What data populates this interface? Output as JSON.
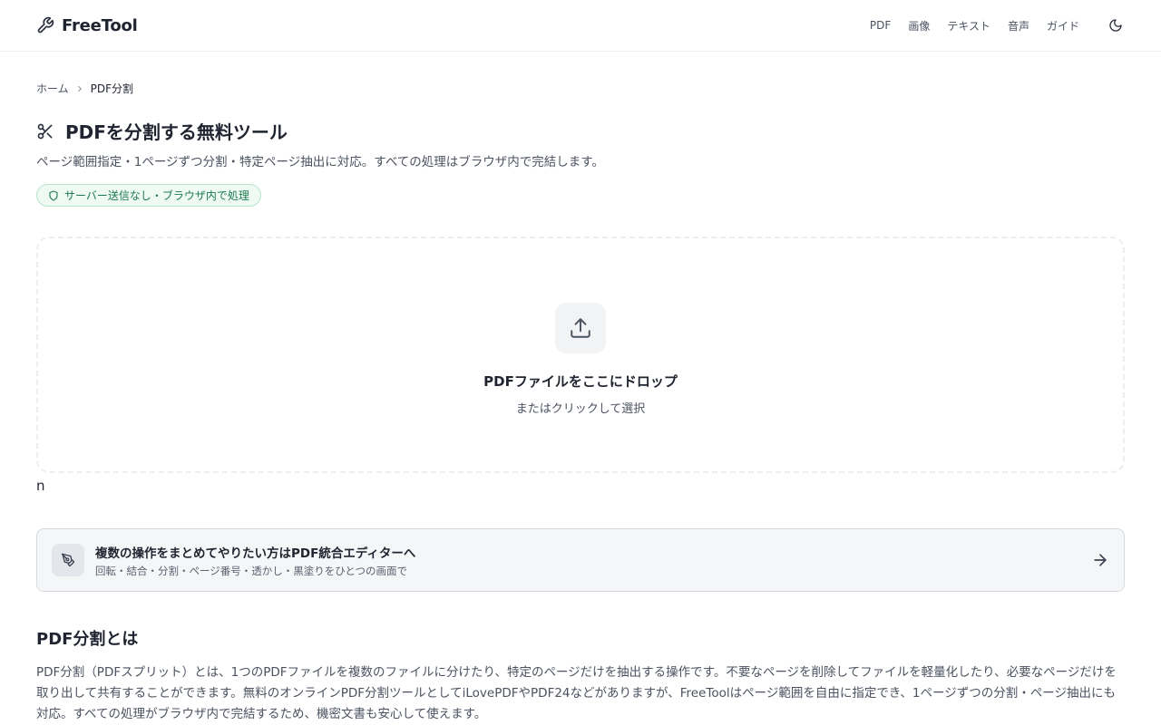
{
  "header": {
    "logo_text": "FreeTool",
    "nav": [
      "PDF",
      "画像",
      "テキスト",
      "音声",
      "ガイド"
    ]
  },
  "breadcrumb": {
    "home": "ホーム",
    "current": "PDF分割"
  },
  "hero": {
    "title": "PDFを分割する無料ツール",
    "subtitle": "ページ範囲指定・1ページずつ分割・特定ページ抽出に対応。すべての処理はブラウザ内で完結します。",
    "badge": "サーバー送信なし・ブラウザ内で処理"
  },
  "dropzone": {
    "title": "PDFファイルをここにドロップ",
    "subtitle": "またはクリックして選択"
  },
  "stray_text": "n",
  "editor_card": {
    "title": "複数の操作をまとめてやりたい方はPDF統合エディターへ",
    "subtitle": "回転・結合・分割・ページ番号・透かし・黒塗りをひとつの画面で"
  },
  "section": {
    "title": "PDF分割とは",
    "body": "PDF分割（PDFスプリット）とは、1つのPDFファイルを複数のファイルに分けたり、特定のページだけを抽出する操作です。不要なページを削除してファイルを軽量化したり、必要なページだけを取り出して共有することができます。無料のオンラインPDF分割ツールとしてiLovePDFやPDF24などがありますが、FreeToolはページ範囲を自由に指定でき、1ページずつの分割・ページ抽出にも対応。すべての処理がブラウザ内で完結するため、機密文書も安心して使えます。"
  },
  "icons": {
    "logo": "wrench-icon",
    "theme": "moon-icon",
    "breadcrumb_sep": "chevron-right-icon",
    "title": "scissors-icon",
    "badge": "shield-icon",
    "upload": "upload-icon",
    "editor": "pen-tool-icon",
    "card_arrow": "arrow-right-icon"
  },
  "colors": {
    "badge_text": "#1e7a4f",
    "badge_bg": "#eefaf3",
    "badge_border": "#b7e4cc",
    "card_bg": "#f5f6f8"
  }
}
